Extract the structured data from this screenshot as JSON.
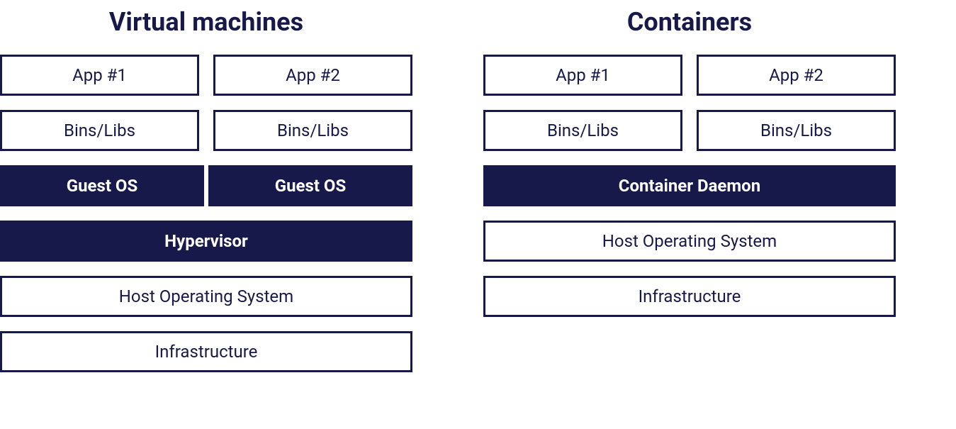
{
  "vm": {
    "title": "Virtual machines",
    "apps": [
      "App #1",
      "App #2"
    ],
    "libs": [
      "Bins/Libs",
      "Bins/Libs"
    ],
    "guestos": [
      "Guest OS",
      "Guest OS"
    ],
    "hypervisor": "Hypervisor",
    "hostos": "Host Operating System",
    "infra": "Infrastructure"
  },
  "containers": {
    "title": "Containers",
    "apps": [
      "App #1",
      "App #2"
    ],
    "libs": [
      "Bins/Libs",
      "Bins/Libs"
    ],
    "daemon": "Container Daemon",
    "hostos": "Host Operating System",
    "infra": "Infrastructure"
  }
}
